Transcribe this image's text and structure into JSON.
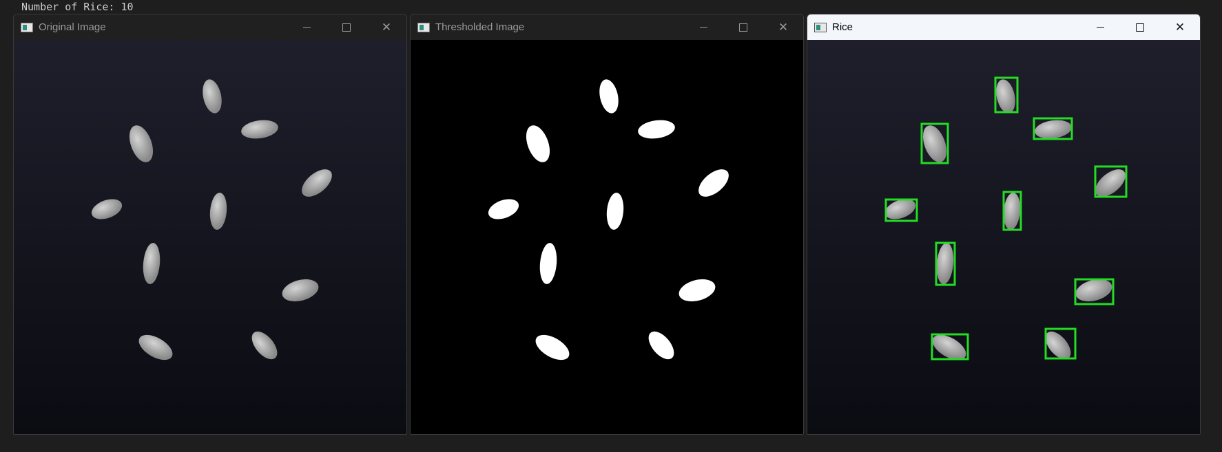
{
  "console": {
    "text": "Number of Rice: 10"
  },
  "windows": [
    {
      "title": "Original Image"
    },
    {
      "title": "Thresholded Image"
    },
    {
      "title": "Rice"
    }
  ],
  "box_color": "#22dd22"
}
